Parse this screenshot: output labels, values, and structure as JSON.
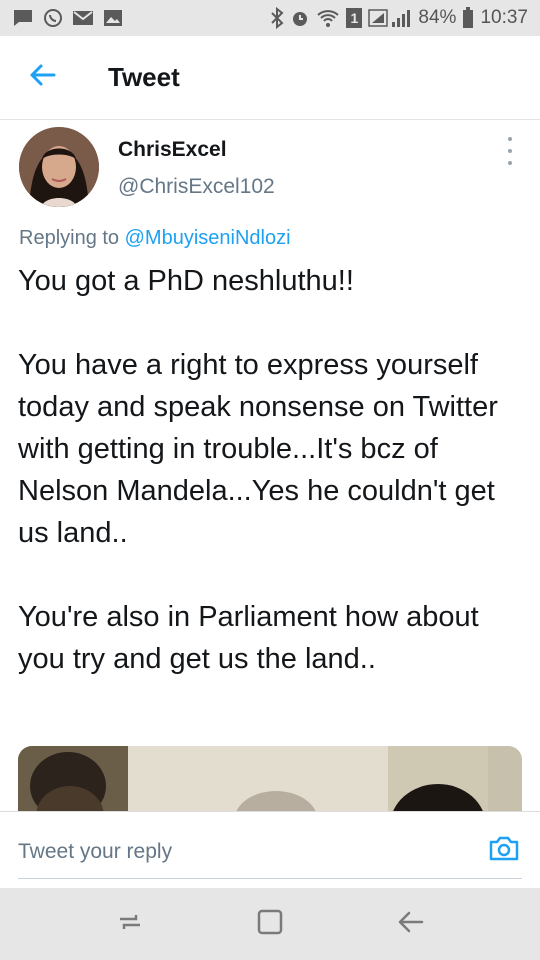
{
  "status_bar": {
    "battery_percent": "84%",
    "time": "10:37",
    "sim_badge": "1",
    "left_icons": [
      "message-icon",
      "whatsapp-icon",
      "gmail-icon",
      "gallery-icon"
    ],
    "right_icons": [
      "bluetooth-icon",
      "alarm-icon",
      "wifi-icon",
      "signal-icon",
      "battery-icon"
    ]
  },
  "app_bar": {
    "title": "Tweet",
    "back_icon": "arrow-left-icon",
    "accent_color": "#1da1f2"
  },
  "tweet": {
    "display_name": "ChrisExcel",
    "handle": "@ChrisExcel102",
    "replying_prefix": "Replying to",
    "replying_to": "@MbuyiseniNdlozi",
    "paragraphs": [
      "You got a PhD neshluthu!!",
      "You have a right to express yourself today and speak nonsense on Twitter with getting in trouble...It's bcz of Nelson Mandela...Yes he couldn't get us land..",
      "You're also in Parliament how about you try and get us the land.."
    ],
    "more_icon": "more-vertical-icon"
  },
  "reply_bar": {
    "placeholder": "Tweet your reply",
    "camera_icon": "camera-icon"
  },
  "nav_bar": {
    "icons": [
      "recent-apps-icon",
      "home-icon",
      "back-icon"
    ]
  }
}
